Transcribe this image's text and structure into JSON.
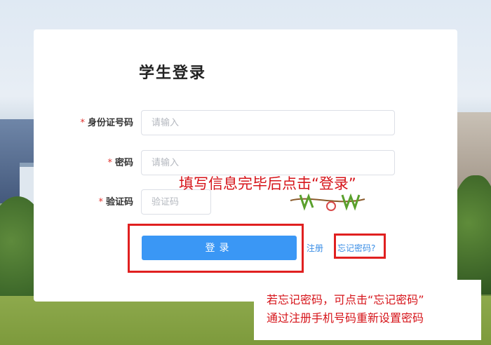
{
  "login": {
    "title": "学生登录",
    "fields": [
      {
        "label": "身份证号码",
        "required_mark": "*",
        "placeholder": "请输入",
        "value": ""
      },
      {
        "label": "密码",
        "required_mark": "*",
        "placeholder": "请输入",
        "value": ""
      },
      {
        "label": "验证码",
        "required_mark": "*",
        "placeholder": "验证码",
        "value": ""
      }
    ],
    "login_button": "登录",
    "register_link": "注册",
    "forgot_link": "忘记密码?"
  },
  "annotations": {
    "instruction": "填写信息完毕后点击“登录”",
    "note_line1": "若忘记密码，可点击“忘记密码”",
    "note_line2": "通过注册手机号码重新设置密码",
    "highlight_color": "#e02020",
    "text_color": "#d6141a"
  },
  "colors": {
    "primary_button": "#3a97f5",
    "link": "#3a8ee6",
    "required": "#e0322e"
  }
}
